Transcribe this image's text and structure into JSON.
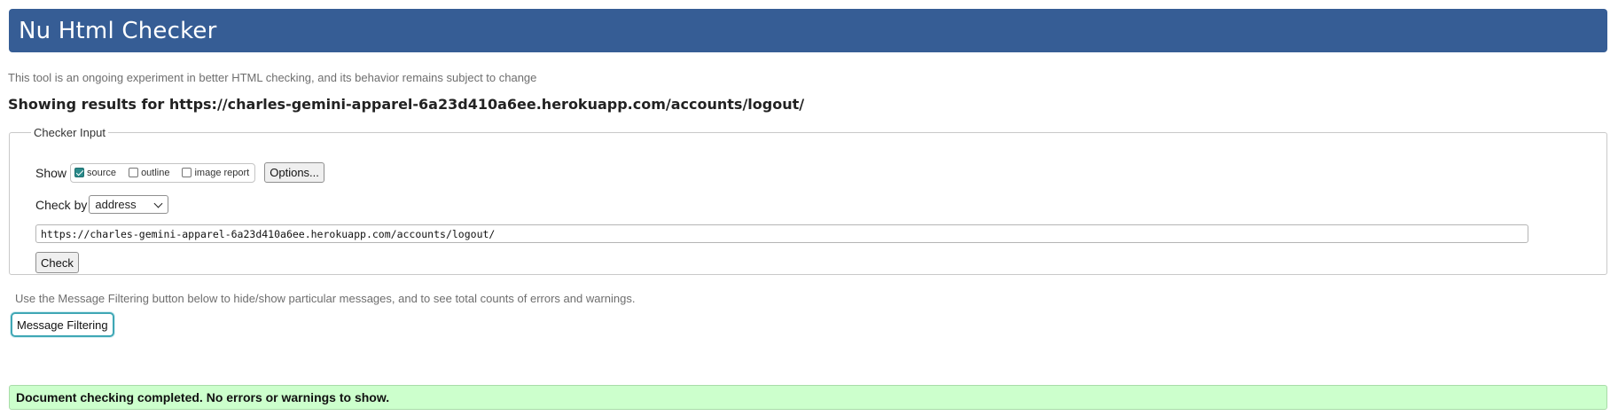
{
  "header": {
    "title": "Nu Html Checker"
  },
  "intro_text": "This tool is an ongoing experiment in better HTML checking, and its behavior remains subject to change",
  "results": {
    "prefix": "Showing results for ",
    "url": "https://charles-gemini-apparel-6a23d410a6ee.herokuapp.com/accounts/logout/"
  },
  "checker_input": {
    "legend": "Checker Input",
    "show_label": "Show",
    "show_options": [
      {
        "label": "source",
        "checked": true
      },
      {
        "label": "outline",
        "checked": false
      },
      {
        "label": "image report",
        "checked": false
      }
    ],
    "options_button": "Options...",
    "check_by_label": "Check by",
    "check_by_value": "address",
    "url_value": "https://charles-gemini-apparel-6a23d410a6ee.herokuapp.com/accounts/logout/",
    "check_button": "Check"
  },
  "filter": {
    "note": "Use the Message Filtering button below to hide/show particular messages, and to see total counts of errors and warnings.",
    "button": "Message Filtering"
  },
  "status": {
    "message": "Document checking completed. No errors or warnings to show.",
    "color": "#ccffcc"
  },
  "colors": {
    "banner": "#365d95",
    "focus_ring": "#3fa7b5"
  }
}
